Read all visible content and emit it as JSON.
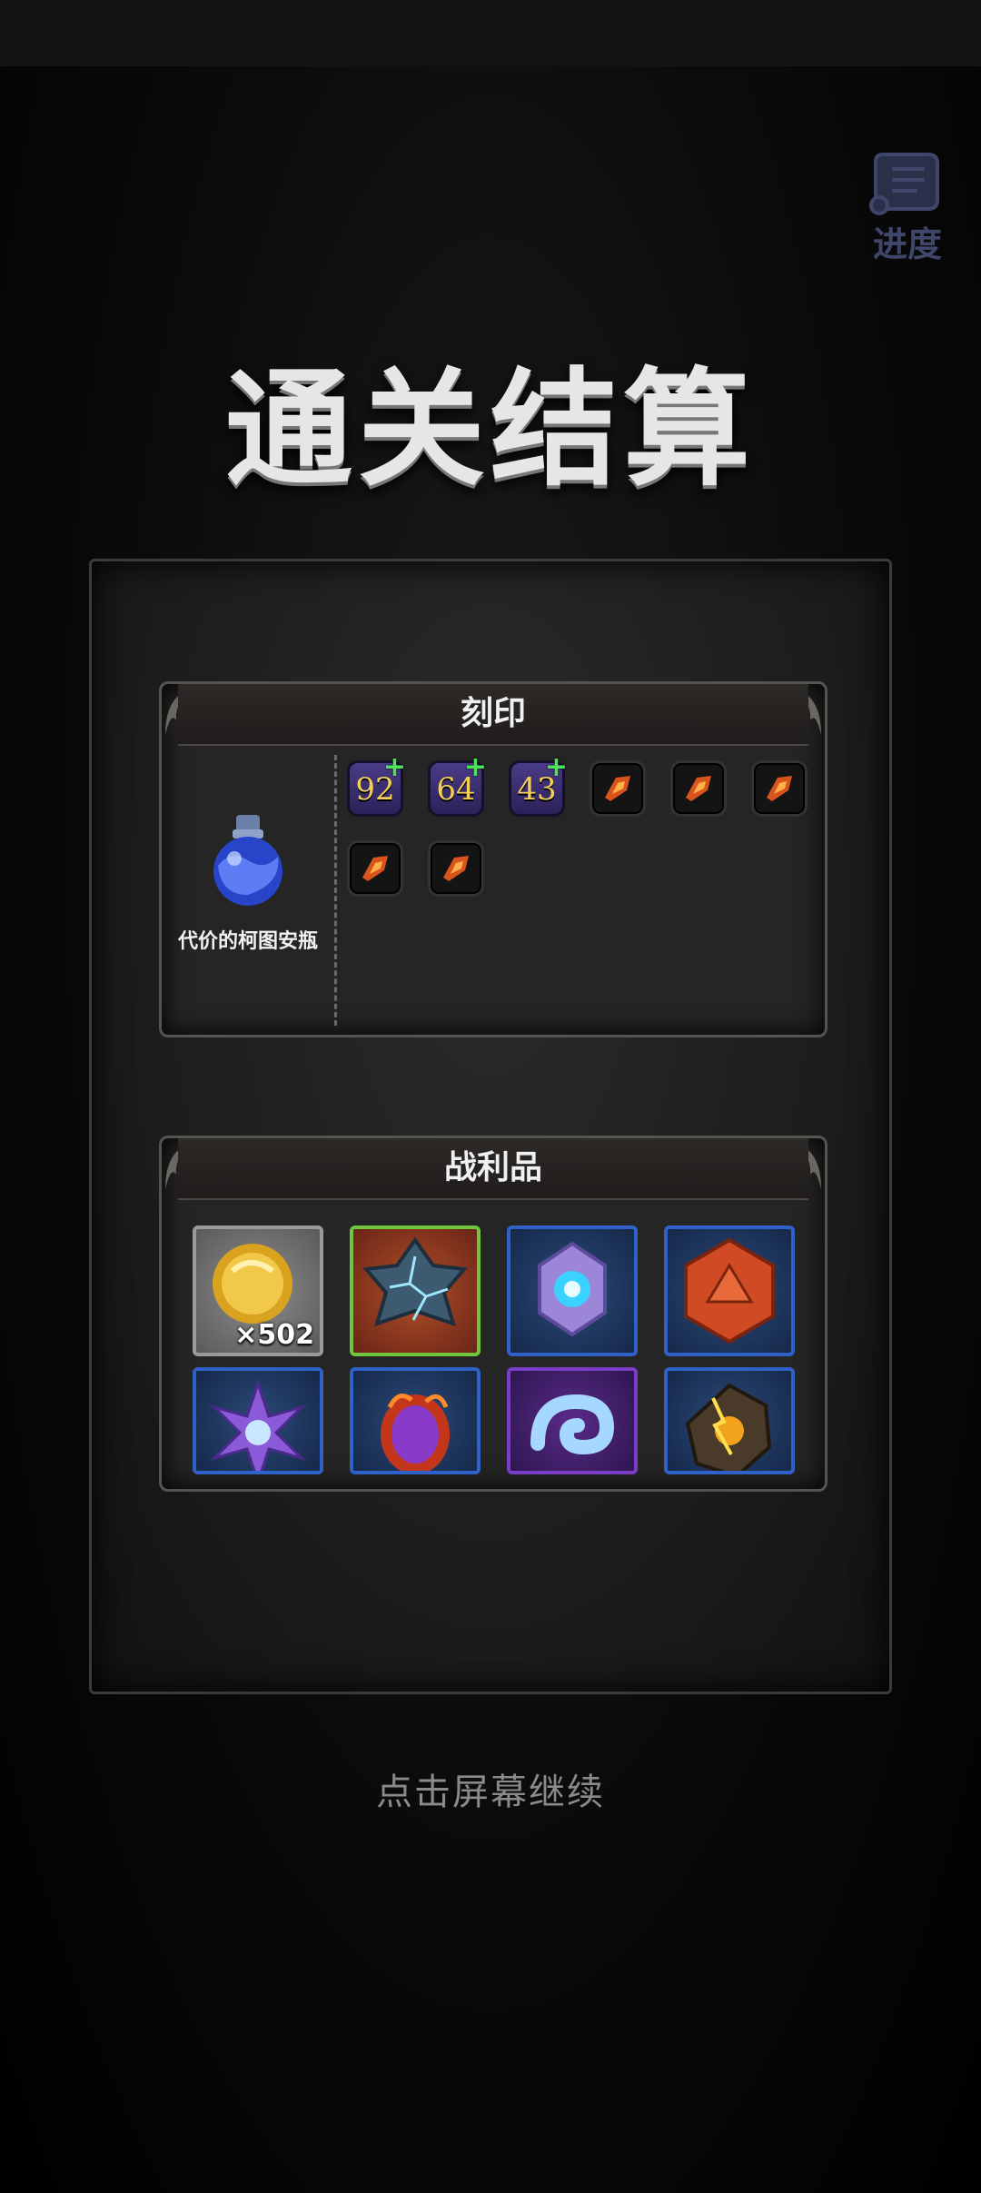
{
  "progress_button": {
    "label": "进度"
  },
  "title": "通关结算",
  "engraving": {
    "header": "刻印",
    "item_name": "代价的柯图安瓶",
    "stamps": [
      {
        "value": "92",
        "has_plus": true
      },
      {
        "value": "64",
        "has_plus": true
      },
      {
        "value": "43",
        "has_plus": true
      },
      {
        "icon": "fire-shard-icon"
      },
      {
        "icon": "fire-shard-icon"
      },
      {
        "icon": "fire-shard-icon"
      },
      {
        "icon": "fire-shard-icon"
      },
      {
        "icon": "fire-shard-icon"
      }
    ],
    "plus_symbol": "+"
  },
  "loot": {
    "header": "战利品",
    "items": [
      {
        "icon": "gold-coin-icon",
        "count": "×502",
        "frame": "gray"
      },
      {
        "icon": "cracked-star-icon",
        "frame": "green"
      },
      {
        "icon": "crystal-orb-icon",
        "frame": "blue"
      },
      {
        "icon": "red-d20-icon",
        "frame": "blue"
      },
      {
        "icon": "purple-crystal-flower-icon",
        "frame": "blue"
      },
      {
        "icon": "molten-egg-icon",
        "frame": "blue"
      },
      {
        "icon": "ice-swirl-icon",
        "frame": "purple"
      },
      {
        "icon": "lightning-rock-icon",
        "frame": "blue"
      }
    ]
  },
  "continue_hint": "点击屏幕继续",
  "colors": {
    "background": "#000000",
    "stamp_number": "#f3cf57",
    "plus": "#4ee45a",
    "frame_blue": "#2f62c8",
    "frame_green": "#6fc63c",
    "frame_purple": "#7b3cc8",
    "frame_gray": "#9a9a9a"
  }
}
